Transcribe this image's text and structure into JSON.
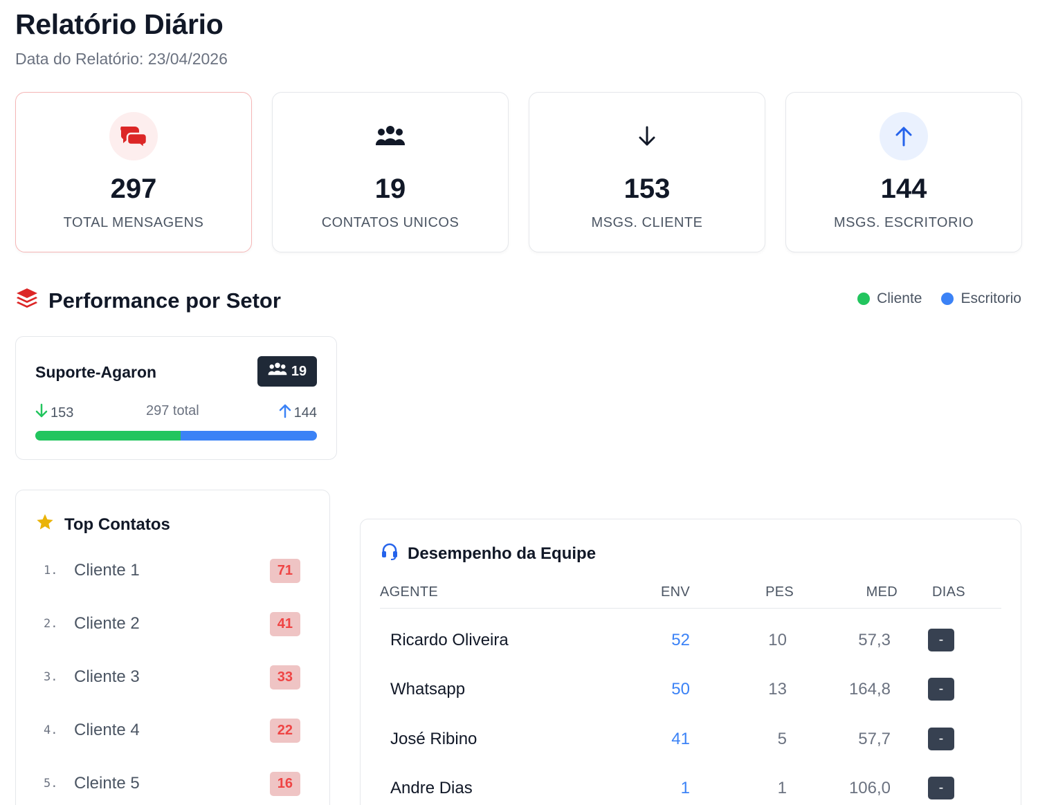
{
  "page": {
    "title": "Relatório Diário",
    "subtitle": "Data do Relatório: 23/04/2026"
  },
  "kpis": [
    {
      "value": "297",
      "label": "TOTAL MENSAGENS",
      "icon": "chat-bubbles-icon",
      "color": "#dc2626"
    },
    {
      "value": "19",
      "label": "CONTATOS UNICOS",
      "icon": "users-icon",
      "color": "#111827"
    },
    {
      "value": "153",
      "label": "MSGS. CLIENTE",
      "icon": "arrow-down-icon",
      "color": "#111827"
    },
    {
      "value": "144",
      "label": "MSGS. ESCRITORIO",
      "icon": "arrow-up-icon",
      "color": "#2563eb"
    }
  ],
  "performance": {
    "title": "Performance por Setor",
    "legend": [
      {
        "label": "Cliente",
        "color": "#22c55e"
      },
      {
        "label": "Escritorio",
        "color": "#3b82f6"
      }
    ],
    "sector": {
      "name": "Suporte-Agaron",
      "contacts": "19",
      "incoming": "153",
      "total": "297 total",
      "outgoing": "144",
      "incoming_share": 0.515
    }
  },
  "top_contacts": {
    "title": "Top Contatos",
    "items": [
      {
        "rank": "1.",
        "name": "Cliente 1",
        "count": "71"
      },
      {
        "rank": "2.",
        "name": "Cliente 2",
        "count": "41"
      },
      {
        "rank": "3.",
        "name": "Cliente 3",
        "count": "33"
      },
      {
        "rank": "4.",
        "name": "Cliente 4",
        "count": "22"
      },
      {
        "rank": "5.",
        "name": "Cleinte 5",
        "count": "16"
      }
    ]
  },
  "team": {
    "title": "Desempenho da Equipe",
    "headers": {
      "agent": "AGENTE",
      "env": "ENV",
      "pes": "PES",
      "med": "MED",
      "dias": "DIAS"
    },
    "rows": [
      {
        "agent": "Ricardo Oliveira",
        "env": "52",
        "pes": "10",
        "med": "57,3",
        "dias": "-"
      },
      {
        "agent": "Whatsapp",
        "env": "50",
        "pes": "13",
        "med": "164,8",
        "dias": "-"
      },
      {
        "agent": "José Ribino",
        "env": "41",
        "pes": "5",
        "med": "57,7",
        "dias": "-"
      },
      {
        "agent": "Andre Dias",
        "env": "1",
        "pes": "1",
        "med": "106,0",
        "dias": "-"
      }
    ]
  }
}
